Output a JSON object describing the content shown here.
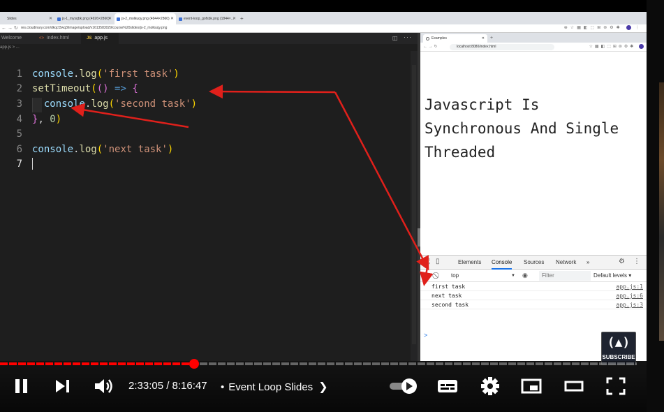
{
  "browser": {
    "tabs": [
      {
        "label": "Slides",
        "active": false
      },
      {
        "label": "js-1_mysqbk.png (4926×2860)",
        "active": false
      },
      {
        "label": "js-2_molkuqy.png (4944×2860)",
        "active": true
      },
      {
        "label": "event-loop_gofsbk.png (1844×...",
        "active": false
      }
    ],
    "url": "res.cloudinary.com/dkqcf3wq3/image/upload/v1613583029/course%20slides/js-2_molkuqy.png"
  },
  "editor": {
    "tabs": [
      {
        "label": "Welcome"
      },
      {
        "label": "index.html"
      },
      {
        "label": "app.js"
      }
    ],
    "breadcrumb": "app.js > ...",
    "line_numbers": [
      "1",
      "2",
      "3",
      "4",
      "5",
      "6",
      "7"
    ]
  },
  "inner_browser": {
    "tab_title": "Examples",
    "url": "localhost:8080/index.html",
    "page_heading_lines": [
      "Javascript Is",
      "Synchronous And Single",
      "Threaded"
    ]
  },
  "devtools": {
    "tabs": [
      "Elements",
      "Console",
      "Sources",
      "Network",
      "»"
    ],
    "active_tab": "Console",
    "context": "top",
    "filter_placeholder": "Filter",
    "levels": "Default levels ▾",
    "logs": [
      {
        "message": "first task",
        "source": "app.js:1"
      },
      {
        "message": "next task",
        "source": "app.js:6"
      },
      {
        "message": "second task",
        "source": "app.js:3"
      }
    ],
    "prompt": ">"
  },
  "subscribe": {
    "glyph": "(▲)",
    "label": "SUBSCRIBE"
  },
  "player": {
    "current_time": "2:33:05",
    "duration": "8:16:47",
    "time_display": "2:33:05 / 8:16:47",
    "chapter": "Event Loop Slides",
    "progress_fraction": 0.305,
    "accent_color": "#ff0000"
  },
  "annotation_color": "#e0201b"
}
